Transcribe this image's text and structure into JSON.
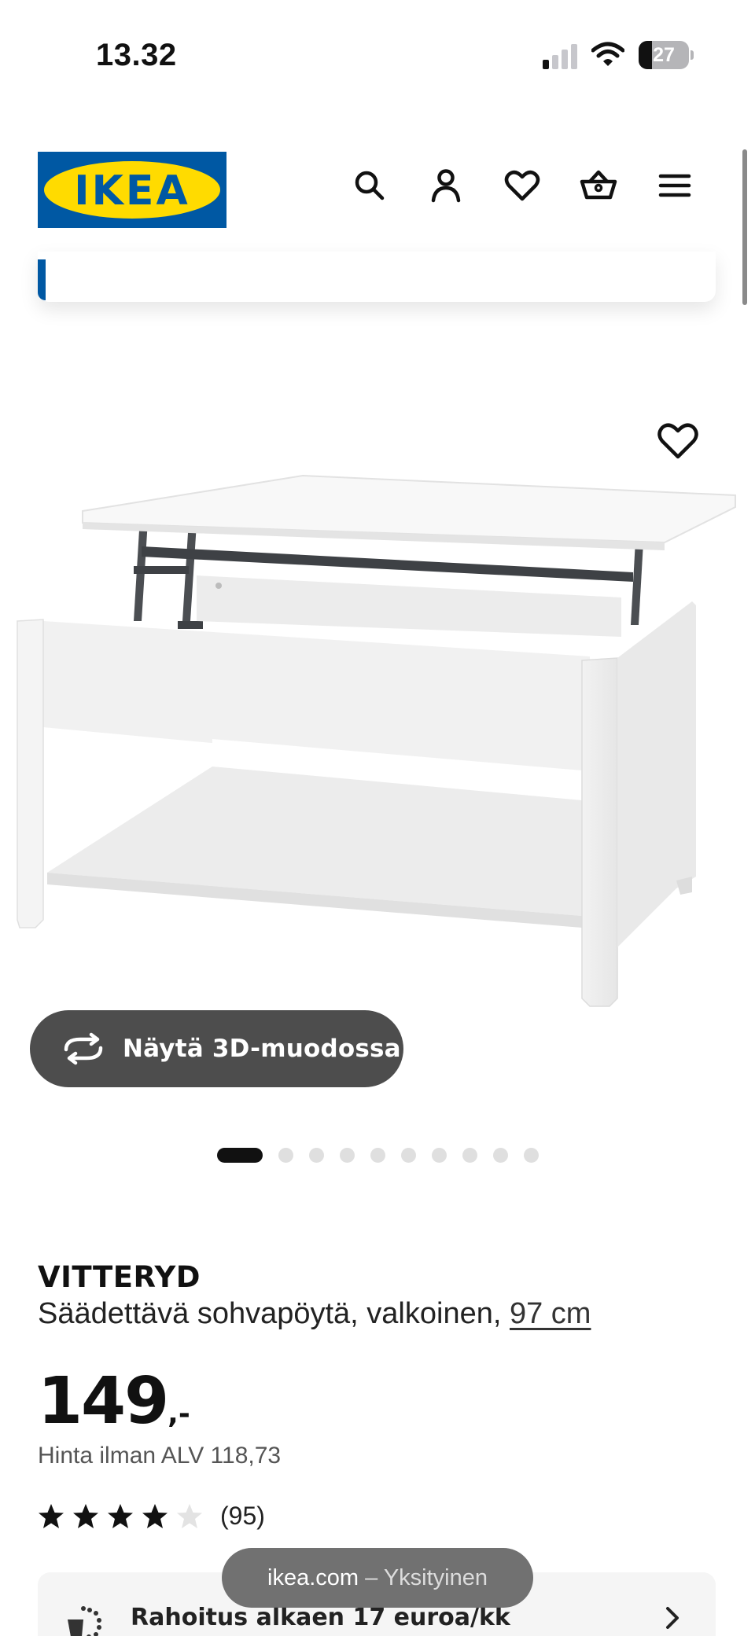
{
  "status_bar": {
    "time": "13.32",
    "battery": "27"
  },
  "header": {
    "logo_text": "IKEA",
    "icons": [
      "search-icon",
      "account-icon",
      "favorites-icon",
      "cart-icon",
      "menu-icon"
    ]
  },
  "product": {
    "view_3d_label": "Näytä 3D-muodossa",
    "image_count": 10,
    "active_image": 1,
    "name": "VITTERYD",
    "description": "Säädettävä sohvapöytä, valkoinen,",
    "size_link": "97 cm",
    "price_integer": "149",
    "price_decimal": ",-",
    "vat_text": "Hinta ilman ALV 118,73",
    "rating_value": 4,
    "rating_max": 5,
    "review_count": "(95)"
  },
  "financing": {
    "label": "Rahoitus alkaen 17 euroa/kk"
  },
  "browser": {
    "domain": "ikea.com",
    "separator": "–",
    "mode": "Yksityinen"
  },
  "colors": {
    "ikea_blue": "#0058a3",
    "ikea_yellow": "#ffdb00",
    "pill_dark": "#4d4d4d"
  }
}
